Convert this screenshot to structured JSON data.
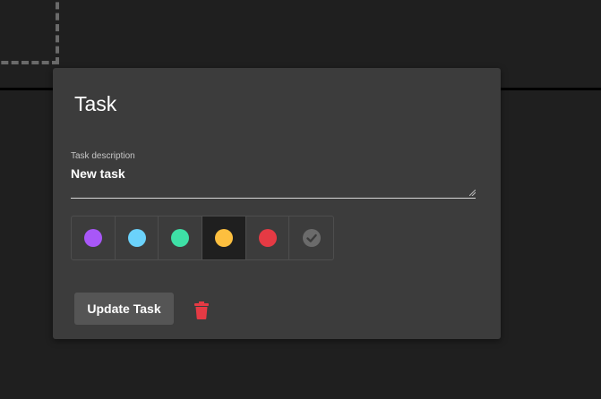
{
  "modal": {
    "title": "Task",
    "description_label": "Task description",
    "description_value": "New task",
    "update_button_label": "Update Task"
  },
  "swatches": [
    {
      "name": "purple",
      "color": "#a857f8",
      "selected": false
    },
    {
      "name": "light-blue",
      "color": "#6bd2fb",
      "selected": false
    },
    {
      "name": "teal",
      "color": "#3ee0a6",
      "selected": false
    },
    {
      "name": "yellow",
      "color": "#fdbf3f",
      "selected": true
    },
    {
      "name": "red",
      "color": "#e53a44",
      "selected": false
    },
    {
      "name": "default-check",
      "color": "#6b6b6b",
      "selected": false
    }
  ],
  "icons": {
    "delete": "trash-icon",
    "check": "check-icon"
  },
  "colors": {
    "modal_bg": "#3c3c3c",
    "page_bg": "#1f1f1f",
    "delete": "#e53a44"
  }
}
